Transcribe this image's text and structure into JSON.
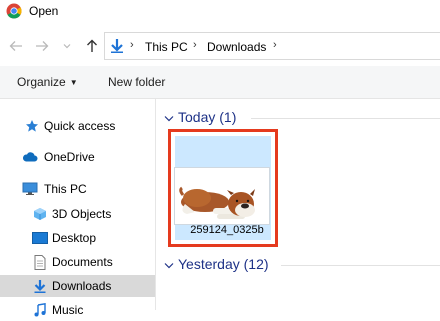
{
  "window": {
    "title": "Open"
  },
  "address": {
    "crumbs": [
      "This PC",
      "Downloads"
    ]
  },
  "commands": {
    "organize": "Organize",
    "new_folder": "New folder"
  },
  "sidebar": {
    "items": [
      {
        "label": "Quick access",
        "icon": "star-icon"
      },
      {
        "label": "OneDrive",
        "icon": "cloud-icon"
      },
      {
        "label": "This PC",
        "icon": "computer-icon"
      },
      {
        "label": "3D Objects",
        "icon": "cube-icon"
      },
      {
        "label": "Desktop",
        "icon": "desktop-icon"
      },
      {
        "label": "Documents",
        "icon": "document-icon"
      },
      {
        "label": "Downloads",
        "icon": "download-icon",
        "selected": true
      },
      {
        "label": "Music",
        "icon": "music-icon"
      }
    ]
  },
  "groups": [
    {
      "label": "Today (1)"
    },
    {
      "label": "Yesterday (12)"
    }
  ],
  "files": [
    {
      "name": "259124_0325b",
      "thumbnail": "bulldog-photo"
    }
  ],
  "colors": {
    "accent": "#1e3287",
    "selection": "#cce8ff",
    "highlight_box": "#e53a1e",
    "sidebar_selected": "#d9d9d9"
  }
}
